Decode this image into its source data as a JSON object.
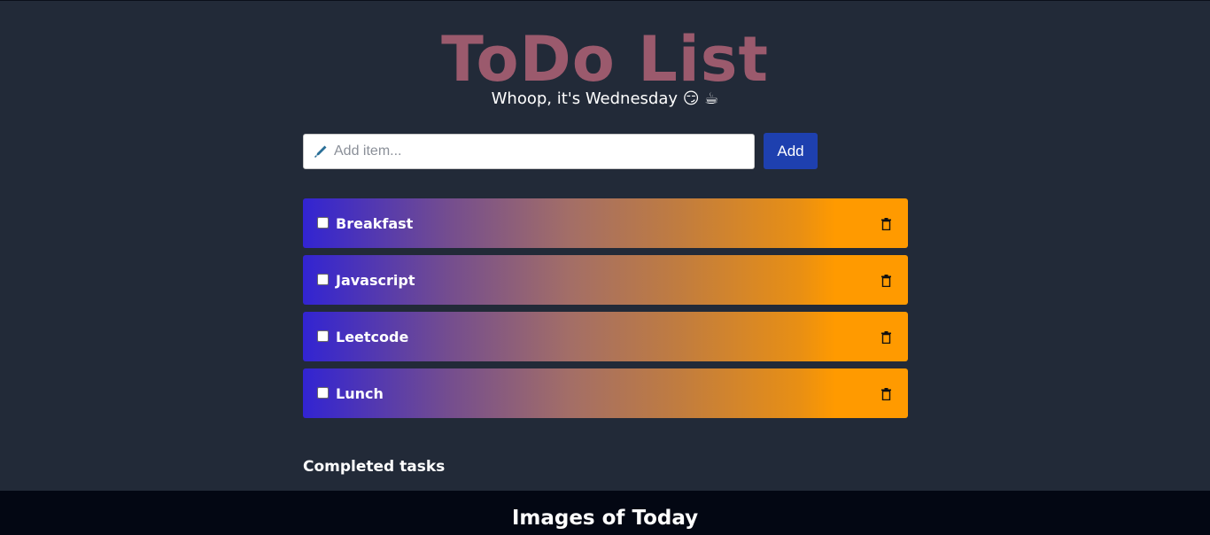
{
  "header": {
    "title": "ToDo List",
    "subtitle": "Whoop, it's Wednesday 😏 ☕"
  },
  "add_form": {
    "placeholder": "Add item...",
    "value": "",
    "add_label": "Add"
  },
  "todos": [
    {
      "label": "Breakfast",
      "checked": false
    },
    {
      "label": "Javascript",
      "checked": false
    },
    {
      "label": "Leetcode",
      "checked": false
    },
    {
      "label": "Lunch",
      "checked": false
    }
  ],
  "completed_heading": "Completed tasks",
  "footer": {
    "title": "Images of Today"
  },
  "icons": {
    "input": "pencil-icon",
    "delete": "trash-icon"
  },
  "colors": {
    "background": "#222a38",
    "title": "#9b5a6d",
    "add_button": "#1e40af",
    "item_gradient_start": "#3224d2",
    "item_gradient_end": "#ff9a00",
    "footer": "#030713"
  }
}
